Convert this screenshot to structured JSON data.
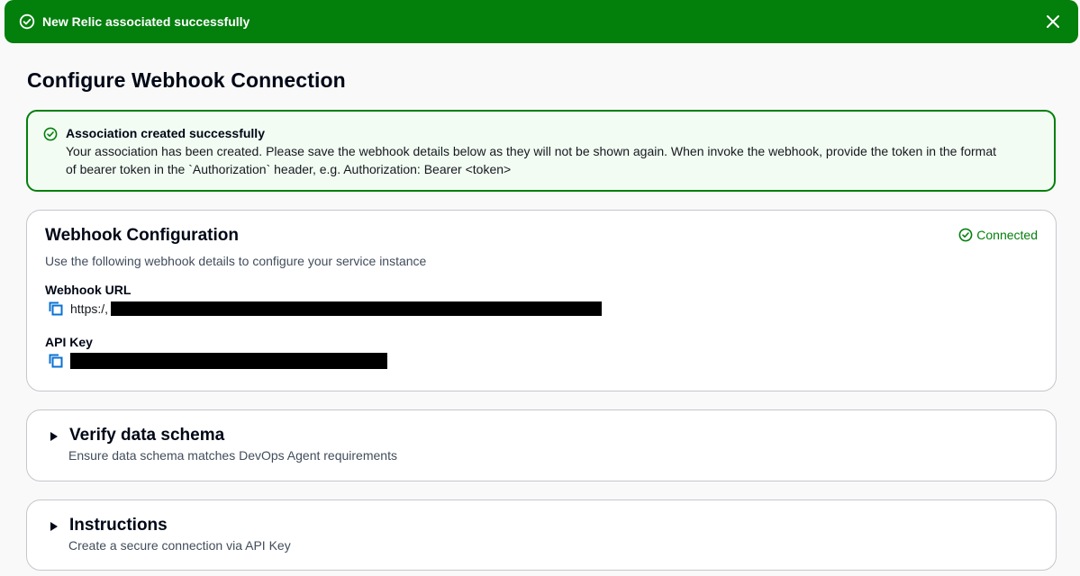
{
  "flash": {
    "message": "New Relic associated successfully",
    "icon": "check-circle-icon",
    "close_icon": "close-icon",
    "background": "#037f0c"
  },
  "page": {
    "title": "Configure Webhook Connection"
  },
  "alert": {
    "title": "Association created successfully",
    "body_line1": "Your association has been created. Please save the webhook details below as they will not be shown again. When invoke the webhook, provide the token in the format",
    "body_line2": "of bearer token in the `Authorization` header, e.g. Authorization: Bearer <token>",
    "border_color": "#037f0c",
    "background": "#f2fcf3"
  },
  "webhook_config": {
    "title": "Webhook Configuration",
    "status": "Connected",
    "description": "Use the following webhook details to configure your service instance",
    "url_label": "Webhook URL",
    "url_prefix": "https:/,",
    "api_key_label": "API Key",
    "copy_icon": "copy-icon"
  },
  "sections": [
    {
      "title": "Verify data schema",
      "description": "Ensure data schema matches DevOps Agent requirements"
    },
    {
      "title": "Instructions",
      "description": "Create a secure connection via API Key"
    }
  ]
}
